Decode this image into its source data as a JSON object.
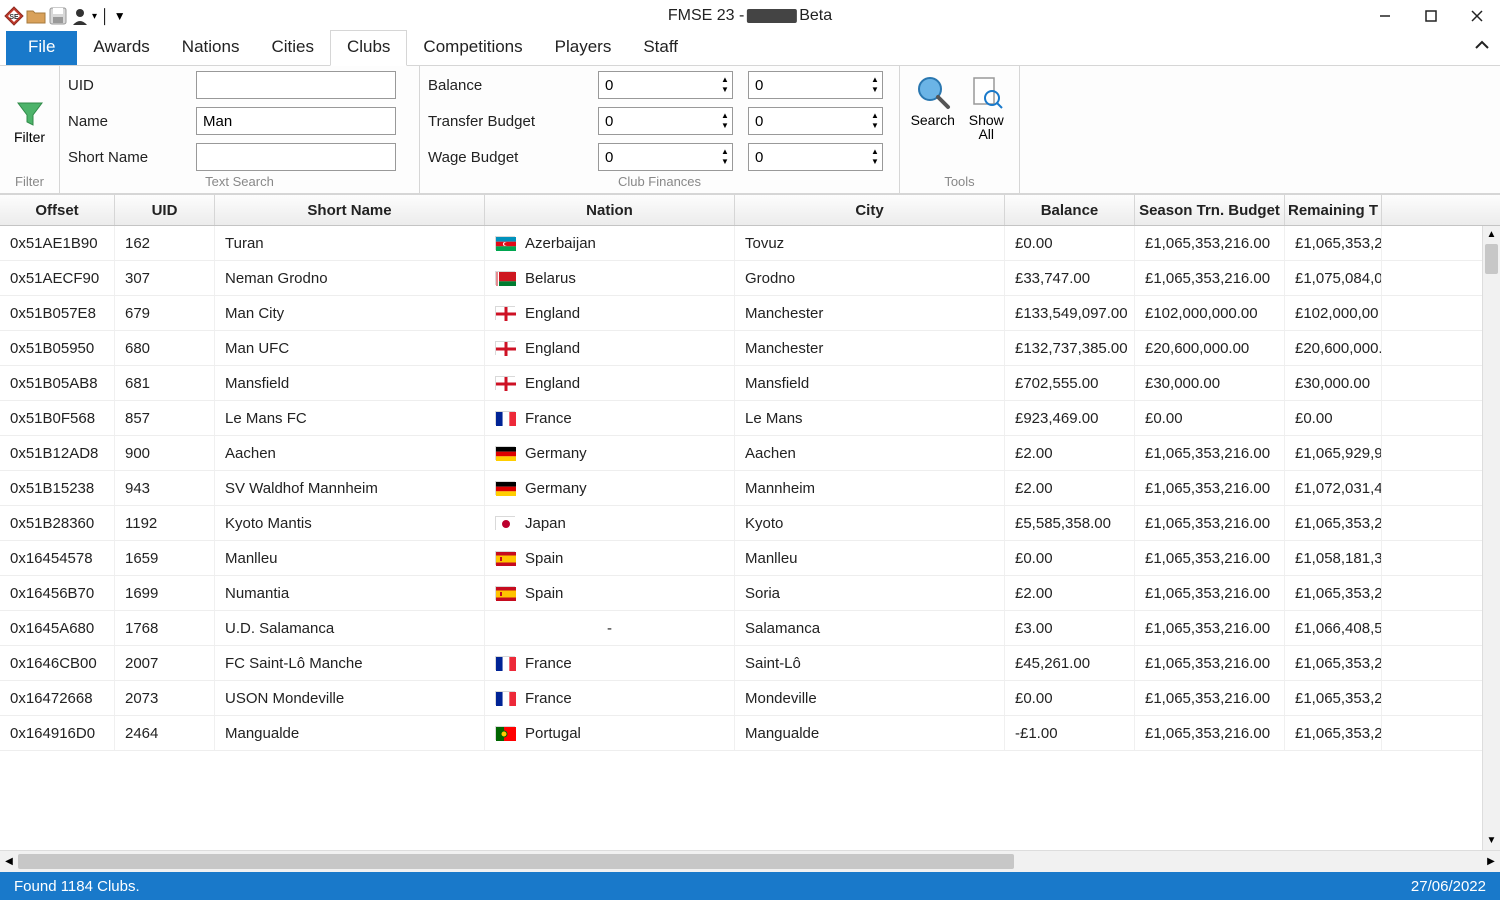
{
  "window": {
    "title_prefix": "FMSE 23 - ",
    "title_suffix": " Beta"
  },
  "tabs": {
    "file": "File",
    "awards": "Awards",
    "nations": "Nations",
    "cities": "Cities",
    "clubs": "Clubs",
    "competitions": "Competitions",
    "players": "Players",
    "staff": "Staff"
  },
  "ribbon": {
    "filter_label": "Filter",
    "filter_group": "Filter",
    "text_search": {
      "uid": "UID",
      "name": "Name",
      "short_name": "Short Name",
      "name_value": "Man",
      "group_label": "Text Search"
    },
    "finances": {
      "balance": "Balance",
      "transfer_budget": "Transfer Budget",
      "wage_budget": "Wage Budget",
      "zero": "0",
      "group_label": "Club Finances"
    },
    "tools": {
      "search": "Search",
      "show_all_1": "Show",
      "show_all_2": "All",
      "group_label": "Tools"
    }
  },
  "columns": {
    "offset": "Offset",
    "uid": "UID",
    "short_name": "Short Name",
    "nation": "Nation",
    "city": "City",
    "balance": "Balance",
    "season_budget": "Season Trn. Budget",
    "remaining": "Remaining T"
  },
  "rows": [
    {
      "offset": "0x51AE1B90",
      "uid": "162",
      "short": "Turan",
      "nation": "Azerbaijan",
      "flag": "az",
      "city": "Tovuz",
      "balance": "£0.00",
      "season": "£1,065,353,216.00",
      "remaining": "£1,065,353,2"
    },
    {
      "offset": "0x51AECF90",
      "uid": "307",
      "short": "Neman Grodno",
      "nation": "Belarus",
      "flag": "by",
      "city": "Grodno",
      "balance": "£33,747.00",
      "season": "£1,065,353,216.00",
      "remaining": "£1,075,084,0"
    },
    {
      "offset": "0x51B057E8",
      "uid": "679",
      "short": "Man City",
      "nation": "England",
      "flag": "en",
      "city": "Manchester",
      "balance": "£133,549,097.00",
      "season": "£102,000,000.00",
      "remaining": "£102,000,00"
    },
    {
      "offset": "0x51B05950",
      "uid": "680",
      "short": "Man UFC",
      "nation": "England",
      "flag": "en",
      "city": "Manchester",
      "balance": "£132,737,385.00",
      "season": "£20,600,000.00",
      "remaining": "£20,600,000."
    },
    {
      "offset": "0x51B05AB8",
      "uid": "681",
      "short": "Mansfield",
      "nation": "England",
      "flag": "en",
      "city": "Mansfield",
      "balance": "£702,555.00",
      "season": "£30,000.00",
      "remaining": "£30,000.00"
    },
    {
      "offset": "0x51B0F568",
      "uid": "857",
      "short": "Le Mans FC",
      "nation": "France",
      "flag": "fr",
      "city": "Le Mans",
      "balance": "£923,469.00",
      "season": "£0.00",
      "remaining": "£0.00"
    },
    {
      "offset": "0x51B12AD8",
      "uid": "900",
      "short": "Aachen",
      "nation": "Germany",
      "flag": "de",
      "city": "Aachen",
      "balance": "£2.00",
      "season": "£1,065,353,216.00",
      "remaining": "£1,065,929,9"
    },
    {
      "offset": "0x51B15238",
      "uid": "943",
      "short": "SV Waldhof Mannheim",
      "nation": "Germany",
      "flag": "de",
      "city": "Mannheim",
      "balance": "£2.00",
      "season": "£1,065,353,216.00",
      "remaining": "£1,072,031,4"
    },
    {
      "offset": "0x51B28360",
      "uid": "1192",
      "short": "Kyoto Mantis",
      "nation": "Japan",
      "flag": "jp",
      "city": "Kyoto",
      "balance": "£5,585,358.00",
      "season": "£1,065,353,216.00",
      "remaining": "£1,065,353,2"
    },
    {
      "offset": "0x16454578",
      "uid": "1659",
      "short": "Manlleu",
      "nation": "Spain",
      "flag": "es",
      "city": "Manlleu",
      "balance": "£0.00",
      "season": "£1,065,353,216.00",
      "remaining": "£1,058,181,3"
    },
    {
      "offset": "0x16456B70",
      "uid": "1699",
      "short": "Numantia",
      "nation": "Spain",
      "flag": "es",
      "city": "Soria",
      "balance": "£2.00",
      "season": "£1,065,353,216.00",
      "remaining": "£1,065,353,2"
    },
    {
      "offset": "0x1645A680",
      "uid": "1768",
      "short": "U.D. Salamanca",
      "nation": "-",
      "flag": "none",
      "city": "Salamanca",
      "balance": "£3.00",
      "season": "£1,065,353,216.00",
      "remaining": "£1,066,408,5"
    },
    {
      "offset": "0x1646CB00",
      "uid": "2007",
      "short": "FC Saint-Lô Manche",
      "nation": "France",
      "flag": "fr",
      "city": "Saint-Lô",
      "balance": "£45,261.00",
      "season": "£1,065,353,216.00",
      "remaining": "£1,065,353,2"
    },
    {
      "offset": "0x16472668",
      "uid": "2073",
      "short": "USON Mondeville",
      "nation": "France",
      "flag": "fr",
      "city": "Mondeville",
      "balance": "£0.00",
      "season": "£1,065,353,216.00",
      "remaining": "£1,065,353,2"
    },
    {
      "offset": "0x164916D0",
      "uid": "2464",
      "short": "Mangualde",
      "nation": "Portugal",
      "flag": "pt",
      "city": "Mangualde",
      "balance": "-£1.00",
      "season": "£1,065,353,216.00",
      "remaining": "£1,065,353,2"
    }
  ],
  "status": {
    "left": "Found 1184 Clubs.",
    "right": "27/06/2022"
  }
}
